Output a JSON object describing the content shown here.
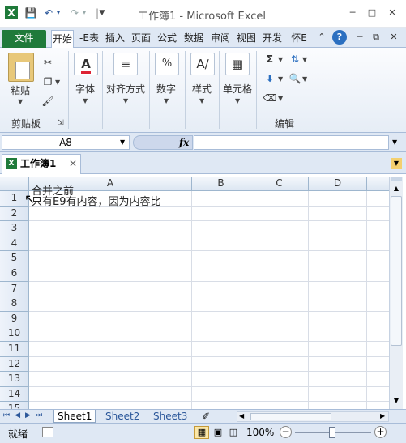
{
  "titlebar": {
    "title": "工作簿1 - Microsoft Excel",
    "excel_icon": "X",
    "quick_access": [
      "save-icon",
      "undo-icon",
      "redo-icon",
      "customize-icon"
    ]
  },
  "tabs": [
    {
      "label": "文件"
    },
    {
      "label": "开始"
    },
    {
      "label": "-E表"
    },
    {
      "label": "插入"
    },
    {
      "label": "页面"
    },
    {
      "label": "公式"
    },
    {
      "label": "数据"
    },
    {
      "label": "审阅"
    },
    {
      "label": "视图"
    },
    {
      "label": "开发"
    },
    {
      "label": "怀E"
    }
  ],
  "ribbon": {
    "clipboard": {
      "paste_label": "粘贴",
      "group_label": "剪贴板"
    },
    "font": {
      "label": "字体"
    },
    "align": {
      "label": "对齐方式"
    },
    "number": {
      "label": "数字"
    },
    "styles": {
      "label": "样式"
    },
    "cells": {
      "label": "单元格"
    },
    "editing": {
      "group_label": "编辑"
    }
  },
  "formulabar": {
    "namebox": "A8",
    "fx": "fx",
    "formula": ""
  },
  "workbook": {
    "tab_label": "工作簿1"
  },
  "grid": {
    "columns": [
      "A",
      "B",
      "C",
      "D"
    ],
    "rows": [
      "1",
      "2",
      "3",
      "4",
      "5",
      "6",
      "7",
      "8",
      "9",
      "10",
      "11",
      "12",
      "13",
      "14",
      "15"
    ],
    "a1_line1": "合并之前",
    "a1_line2": "只有E9有内容，因为内容比"
  },
  "sheets": {
    "tabs": [
      "Sheet1",
      "Sheet2",
      "Sheet3"
    ]
  },
  "status": {
    "ready": "就绪",
    "zoom": "100%",
    "zoom_level": 100
  },
  "colors": {
    "file_tab": "#1f7a3a",
    "accent": "#2b579a",
    "header_border": "#9eb6ce"
  }
}
